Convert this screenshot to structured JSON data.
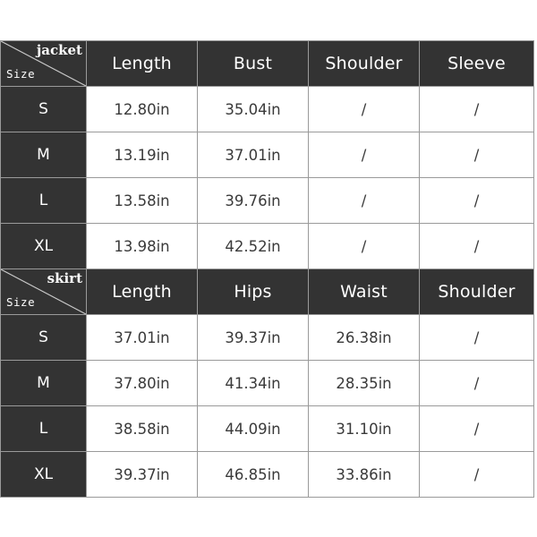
{
  "page": {
    "background_color": "#ffffff",
    "header_color": "#333333",
    "cell_color": "#ffffff",
    "border_color": "#9a9a9a",
    "header_text_color": "#ffffff",
    "data_text_color": "#3a3a3a"
  },
  "tables": [
    {
      "id": "jacket",
      "corner": {
        "garment_label": "jacket",
        "axis_label": "Size"
      },
      "columns": [
        "Length",
        "Bust",
        "Shoulder",
        "Sleeve"
      ],
      "rows": [
        {
          "size": "S",
          "values": [
            "12.80in",
            "35.04in",
            "/",
            "/"
          ]
        },
        {
          "size": "M",
          "values": [
            "13.19in",
            "37.01in",
            "/",
            "/"
          ]
        },
        {
          "size": "L",
          "values": [
            "13.58in",
            "39.76in",
            "/",
            "/"
          ]
        },
        {
          "size": "XL",
          "values": [
            "13.98in",
            "42.52in",
            "/",
            "/"
          ]
        }
      ]
    },
    {
      "id": "skirt",
      "corner": {
        "garment_label": "skirt",
        "axis_label": "Size"
      },
      "columns": [
        "Length",
        "Hips",
        "Waist",
        "Shoulder"
      ],
      "rows": [
        {
          "size": "S",
          "values": [
            "37.01in",
            "39.37in",
            "26.38in",
            "/"
          ]
        },
        {
          "size": "M",
          "values": [
            "37.80in",
            "41.34in",
            "28.35in",
            "/"
          ]
        },
        {
          "size": "L",
          "values": [
            "38.58in",
            "44.09in",
            "31.10in",
            "/"
          ]
        },
        {
          "size": "XL",
          "values": [
            "39.37in",
            "46.85in",
            "33.86in",
            "/"
          ]
        }
      ]
    }
  ]
}
